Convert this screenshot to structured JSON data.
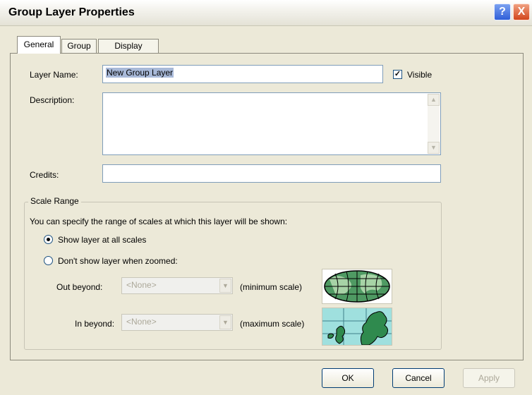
{
  "window": {
    "title": "Group Layer Properties"
  },
  "titlebar": {
    "help_glyph": "?",
    "close_glyph": "X"
  },
  "tabs": [
    {
      "label": "General",
      "active": true
    },
    {
      "label": "Group",
      "active": false
    },
    {
      "label": "Display",
      "active": false
    }
  ],
  "general": {
    "layer_name_label": "Layer Name:",
    "layer_name_value": "New Group Layer",
    "visible_label": "Visible",
    "visible_checked": true,
    "description_label": "Description:",
    "description_value": "",
    "credits_label": "Credits:",
    "credits_value": ""
  },
  "scale_range": {
    "legend": "Scale Range",
    "intro": "You can specify the range of scales at which this layer will be shown:",
    "options": [
      {
        "label": "Show layer at all scales",
        "selected": true
      },
      {
        "label": "Don't show layer when zoomed:",
        "selected": false
      }
    ],
    "out_beyond_label": "Out beyond:",
    "out_beyond_value": "<None>",
    "minimum_scale_label": "(minimum scale)",
    "in_beyond_label": "In beyond:",
    "in_beyond_value": "<None>",
    "maximum_scale_label": "(maximum scale)",
    "world_icon": "world-map-icon",
    "europe_icon": "europe-map-icon"
  },
  "footer": {
    "ok_label": "OK",
    "cancel_label": "Cancel",
    "apply_label": "Apply"
  },
  "colors": {
    "accent": "#316AC5",
    "dialog_bg": "#ECE9D8",
    "selection": "#A8B9D8"
  }
}
